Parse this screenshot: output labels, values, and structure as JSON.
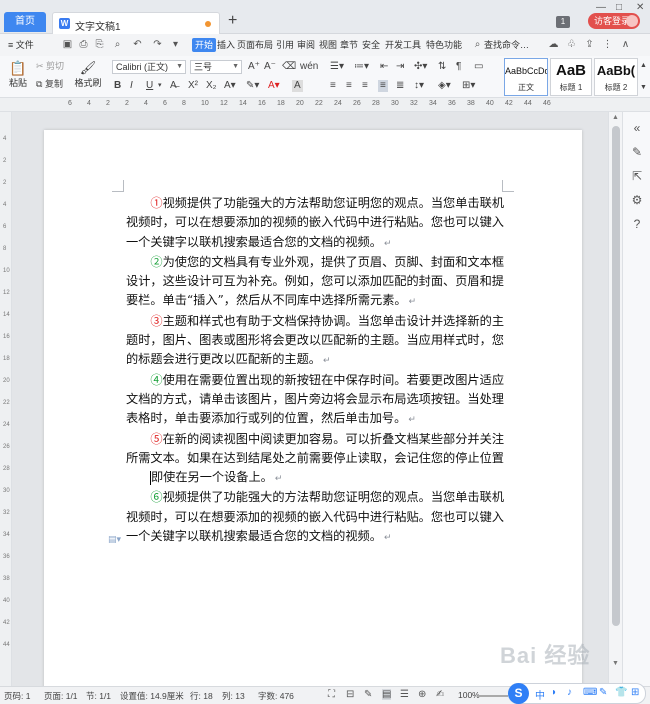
{
  "titlebar": {
    "home_tab": "首页",
    "doc_tab": "文字文稿1",
    "add_tab": "+",
    "page_badge": "1",
    "login": "访客登录",
    "minimize": "—",
    "maximize": "□",
    "close": "✕"
  },
  "menubar": {
    "file": "≡ 文件",
    "tabs": [
      "开始",
      "插入",
      "页面布局",
      "引用",
      "审阅",
      "视图",
      "章节",
      "安全",
      "开发工具",
      "特色功能"
    ],
    "search": "查找命令…"
  },
  "ribbon": {
    "paste": "粘贴",
    "cut": "剪切",
    "copy": "复制",
    "format_painter": "格式刷",
    "font_name": "Calibri (正文)",
    "font_size": "三号",
    "bold": "B",
    "italic": "I",
    "underline": "U",
    "styles": [
      {
        "sample": "AaBbCcDd",
        "caption": "正文"
      },
      {
        "sample": "AaB",
        "caption": "标题 1"
      },
      {
        "sample": "AaBb(",
        "caption": "标题 2"
      }
    ]
  },
  "ruler": {
    "marks": [
      "6",
      "4",
      "2",
      "2",
      "4",
      "6",
      "8",
      "10",
      "12",
      "14",
      "16",
      "18",
      "20",
      "22",
      "24",
      "26",
      "28",
      "30",
      "32",
      "34",
      "36",
      "38",
      "40",
      "42",
      "44",
      "46"
    ]
  },
  "vruler": {
    "marks": [
      "4",
      "2",
      "2",
      "4",
      "6",
      "8",
      "10",
      "12",
      "14",
      "16",
      "18",
      "20",
      "22",
      "24",
      "26",
      "28",
      "30",
      "32",
      "34",
      "36",
      "38",
      "40",
      "42",
      "44"
    ]
  },
  "document": {
    "paragraphs": [
      {
        "num": "①",
        "color": "#e02424",
        "text": "视频提供了功能强大的方法帮助您证明您的观点。当您单击联机视频时，可以在想要添加的视频的嵌入代码中进行粘贴。您也可以键入一个关键字以联机搜索最适合您的文档的视频。"
      },
      {
        "num": "②",
        "color": "#19a13a",
        "text": "为使您的文档具有专业外观，提供了页眉、页脚、封面和文本框设计，这些设计可互为补充。例如，您可以添加匹配的封面、页眉和提要栏。单击“插入”，然后从不同库中选择所需元素。"
      },
      {
        "num": "③",
        "color": "#e02424",
        "text": "主题和样式也有助于文档保持协调。当您单击设计并选择新的主题时，图片、图表或图形将会更改以匹配新的主题。当应用样式时，您的标题会进行更改以匹配新的主题。"
      },
      {
        "num": "④",
        "color": "#19a13a",
        "text": "使用在需要位置出现的新按钮在中保存时间。若要更改图片适应文档的方式，请单击该图片，图片旁边将会显示布局选项按钮。当处理表格时，单击要添加行或列的位置，然后单击加号。"
      },
      {
        "num": "⑤",
        "color": "#e02424",
        "text_before": "在新的阅读视图中阅读更加容易。可以折叠文档某些部分并关注所需文本。如果在达到结尾处之前需要停止读取，会记住您的停止位置",
        "text_after": "即使在另一个设备上。"
      },
      {
        "num": "⑥",
        "color": "#19a13a",
        "text": "视频提供了功能强大的方法帮助您证明您的观点。当您单击联机视频时，可以在想要添加的视频的嵌入代码中进行粘贴。您也可以键入一个关键字以联机搜索最适合您的文档的视频。"
      }
    ],
    "paragraph_mark": "↵"
  },
  "statusbar": {
    "page_num": "页码: 1",
    "pages": "页面: 1/1",
    "section": "节: 1/1",
    "setting": "设置值: 14.9厘米",
    "row": "行: 18",
    "col": "列: 13",
    "words": "字数: 476",
    "zoom": "100%"
  },
  "ime": {
    "logo": "S",
    "items": [
      "中",
      "◗",
      "♪",
      "⌨",
      "✎",
      "👕",
      "⊞"
    ]
  },
  "watermark": "Bai 经验"
}
